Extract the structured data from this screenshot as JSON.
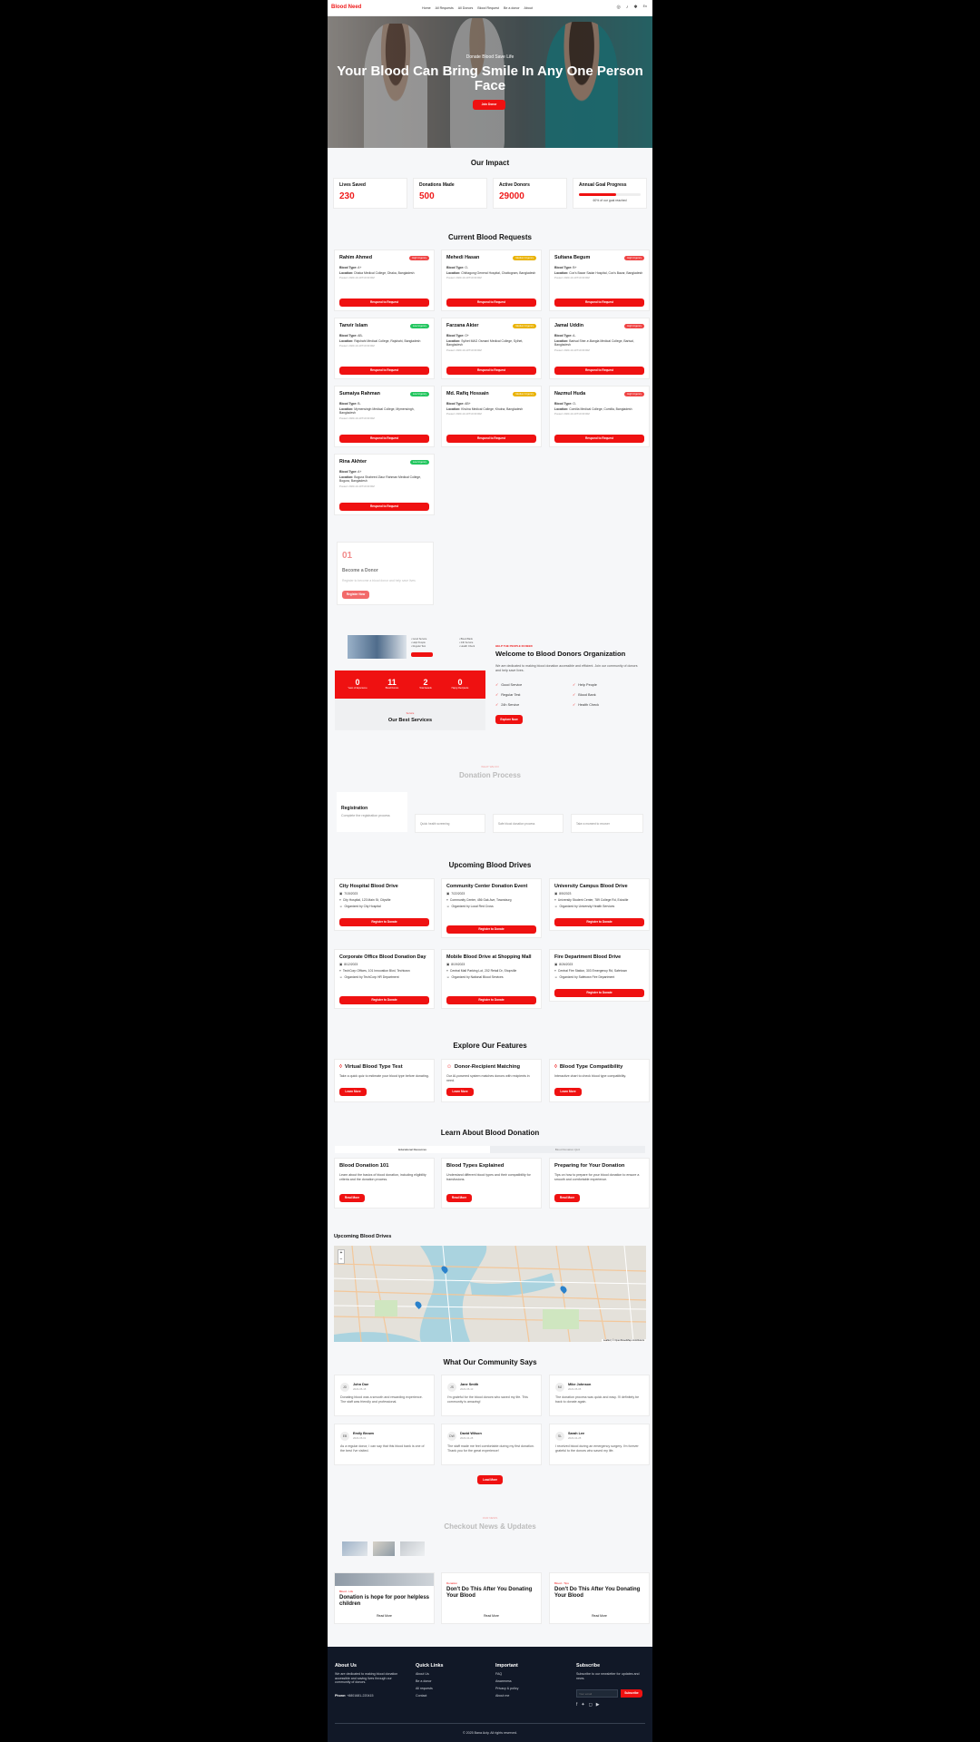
{
  "nav": {
    "logo": "Blood Need",
    "links": [
      "Home",
      "All Requests",
      "All Donors",
      "Blood Request",
      "Be a donor",
      "About"
    ],
    "lang": "En"
  },
  "hero": {
    "kicker": "Donate Blood Save Life",
    "title": "Your Blood Can Bring Smile In Any One Person Face",
    "button": "Join Donor"
  },
  "impact": {
    "title": "Our Impact",
    "stats": [
      {
        "label": "Lives Saved",
        "value": "230"
      },
      {
        "label": "Donations Made",
        "value": "500"
      },
      {
        "label": "Active Donors",
        "value": "29000"
      }
    ],
    "goal_label": "Annual Goal Progress",
    "goal_percent": 60,
    "goal_text": "60% of our goal reached"
  },
  "requests": {
    "title": "Current Blood Requests",
    "blood_type_label": "Blood Type:",
    "location_label": "Location:",
    "button": "Respond to Request",
    "items": [
      {
        "name": "Rahim Ahmed",
        "urgency": "High Urgency",
        "color": "#ef4444",
        "blood": "A+",
        "location": "Dhaka Medical College, Dhaka, Bangladesh",
        "posted": "Posted: 2023-10-10T10:30:00Z"
      },
      {
        "name": "Mehedi Hasan",
        "urgency": "Medium Urgency",
        "color": "#eab308",
        "blood": "O-",
        "location": "Chittagong General Hospital, Chattogram, Bangladesh",
        "posted": "Posted: 2023-10-10T10:30:00Z"
      },
      {
        "name": "Sultana Begum",
        "urgency": "High Urgency",
        "color": "#ef4444",
        "blood": "B+",
        "location": "Cox's Bazar Sadar Hospital, Cox's Bazar, Bangladesh",
        "posted": "Posted: 2023-10-10T10:30:00Z"
      },
      {
        "name": "Tanvir Islam",
        "urgency": "Low Urgency",
        "color": "#22c55e",
        "blood": "AB-",
        "location": "Rajshahi Medical College, Rajshahi, Bangladesh",
        "posted": "Posted: 2023-10-10T10:30:00Z"
      },
      {
        "name": "Farzana Akter",
        "urgency": "Medium Urgency",
        "color": "#eab308",
        "blood": "O+",
        "location": "Sylhet MAG Osmani Medical College, Sylhet, Bangladesh",
        "posted": "Posted: 2023-10-10T10:30:00Z"
      },
      {
        "name": "Jamal Uddin",
        "urgency": "High Urgency",
        "color": "#ef4444",
        "blood": "A-",
        "location": "Barisal Sher-e-Bangla Medical College, Barisal, Bangladesh",
        "posted": "Posted: 2023-10-10T10:30:00Z"
      },
      {
        "name": "Sumaiya Rahman",
        "urgency": "Low Urgency",
        "color": "#22c55e",
        "blood": "B-",
        "location": "Mymensingh Medical College, Mymensingh, Bangladesh",
        "posted": "Posted: 2023-10-10T10:30:00Z"
      },
      {
        "name": "Md. Rafiq Hossain",
        "urgency": "Medium Urgency",
        "color": "#eab308",
        "blood": "AB+",
        "location": "Khulna Medical College, Khulna, Bangladesh",
        "posted": "Posted: 2023-10-10T10:30:00Z"
      },
      {
        "name": "Nazmul Huda",
        "urgency": "High Urgency",
        "color": "#ef4444",
        "blood": "O-",
        "location": "Comilla Medical College, Cumilla, Bangladesh",
        "posted": "Posted: 2023-10-10T10:30:00Z"
      },
      {
        "name": "Rina Akhter",
        "urgency": "Low Urgency",
        "color": "#22c55e",
        "blood": "A+",
        "location": "Bogura Shaheed Ziaur Rahman Medical College, Bogura, Bangladesh",
        "posted": "Posted: 2023-10-10T10:30:00Z"
      }
    ]
  },
  "become": {
    "number": "01",
    "title": "Become a Donor",
    "text": "Register to become a blood donor and help save lives",
    "button": "Register Now"
  },
  "welcome": {
    "stats": [
      {
        "value": "0",
        "label": "Years of Experience"
      },
      {
        "value": "11",
        "label": "Blood Donors"
      },
      {
        "value": "2",
        "label": "Total Awards"
      },
      {
        "value": "0",
        "label": "Happy Recipients"
      }
    ],
    "services_kicker": "Service",
    "services_title": "Our Best Services",
    "kicker": "HELP THE PEOPLE IN NEED",
    "title": "Welcome to Blood Donors Organization",
    "text": "We are dedicated to making blood donation accessible and efficient. Join our community of donors and help save lives.",
    "checks": [
      "Good Service",
      "Help People",
      "Regular Test",
      "Blood Bank",
      "24h Service",
      "Health Check"
    ],
    "button": "Explore Now"
  },
  "process": {
    "kicker": "WHAT WE DO",
    "title": "Donation Process",
    "step_title": "Registration",
    "step_text": "Complete the registration process",
    "steps": [
      "Quick health screening",
      "Safe blood donation process",
      "Take a moment to recover"
    ]
  },
  "drives": {
    "title": "Upcoming Blood Drives",
    "button": "Register to Donate",
    "items": [
      {
        "name": "City Hospital Blood Drive",
        "date": "7/15/2023",
        "place": "City Hospital, 123 Main St, Cityville",
        "org": "Organized by City Hospital"
      },
      {
        "name": "Community Center Donation Event",
        "date": "7/22/2023",
        "place": "Community Center, 456 Oak Ave, Townsburg",
        "org": "Organized by Local Red Cross"
      },
      {
        "name": "University Campus Blood Drive",
        "date": "8/5/2023",
        "place": "University Student Center, 789 College Rd, Eduville",
        "org": "Organized by University Health Services"
      },
      {
        "name": "Corporate Office Blood Donation Day",
        "date": "8/12/2023",
        "place": "TechCorp Offices, 101 Innovation Blvd, Techtown",
        "org": "Organized by TechCorp HR Department"
      },
      {
        "name": "Mobile Blood Drive at Shopping Mall",
        "date": "8/19/2023",
        "place": "Central Mall Parking Lot, 202 Retail Dr, Shopville",
        "org": "Organized by National Blood Services"
      },
      {
        "name": "Fire Department Blood Drive",
        "date": "8/26/2023",
        "place": "Central Fire Station, 303 Emergency Rd, Safetown",
        "org": "Organized by Safetown Fire Department"
      }
    ]
  },
  "features": {
    "title": "Explore Our Features",
    "button": "Learn More",
    "items": [
      {
        "name": "Virtual Blood Type Test",
        "text": "Take a quick quiz to estimate your blood type before donating."
      },
      {
        "name": "Donor-Recipient Matching",
        "text": "Our AI-powered system matches donors with recipients in need."
      },
      {
        "name": "Blood Type Compatibility",
        "text": "Interactive chart to check blood type compatibility."
      }
    ]
  },
  "learn": {
    "title": "Learn About Blood Donation",
    "tabs": [
      "Educational Resources",
      "Blood Donation Quiz"
    ],
    "button": "Read More",
    "items": [
      {
        "name": "Blood Donation 101",
        "text": "Learn about the basics of blood donation, including eligibility criteria and the donation process."
      },
      {
        "name": "Blood Types Explained",
        "text": "Understand different blood types and their compatibility for transfusions."
      },
      {
        "name": "Preparing for Your Donation",
        "text": "Tips on how to prepare for your blood donation to ensure a smooth and comfortable experience."
      }
    ]
  },
  "map": {
    "title": "Upcoming Blood Drives",
    "zoom_in": "+",
    "zoom_out": "−",
    "attribution": "Leaflet | © OpenStreetMap contributors"
  },
  "testimonials": {
    "title": "What Our Community Says",
    "button": "Load More",
    "items": [
      {
        "initials": "JD",
        "name": "John Doe",
        "date": "2023-05-15",
        "text": "Donating blood was a smooth and rewarding experience. The staff was friendly and professional."
      },
      {
        "initials": "JS",
        "name": "Jane Smith",
        "date": "2023-05-10",
        "text": "I'm grateful for the blood donors who saved my life. This community is amazing!"
      },
      {
        "initials": "MJ",
        "name": "Mike Johnson",
        "date": "2023-05-05",
        "text": "The donation process was quick and easy. I'll definitely be back to donate again."
      },
      {
        "initials": "EB",
        "name": "Emily Brown",
        "date": "2023-05-01",
        "text": "As a regular donor, I can say that this blood bank is one of the best I've visited."
      },
      {
        "initials": "DW",
        "name": "David Wilson",
        "date": "2023-04-28",
        "text": "The staff made me feel comfortable during my first donation. Thank you for the great experience!"
      },
      {
        "initials": "SL",
        "name": "Sarah Lee",
        "date": "2023-04-25",
        "text": "I received blood during an emergency surgery. I'm forever grateful to the donors who saved my life."
      }
    ]
  },
  "news": {
    "kicker": "OUR NEWS",
    "title": "Checkout News & Updates",
    "read_more": "Read More",
    "items": [
      {
        "tag": "Blood - Life",
        "name": "Donation is hope for poor helpless children"
      },
      {
        "tag": "Donation",
        "name": "Don't Do This After You Donating Your Blood"
      },
      {
        "tag": "Blood - Tips",
        "name": "Don't Do This After You Donating Your Blood"
      }
    ]
  },
  "footer": {
    "about_title": "About Us",
    "about_text": "We are dedicated to making blood donation accessible and saving lives through our community of donors.",
    "phone_label": "Phone:",
    "phone": "+8801681-220415",
    "quick_title": "Quick Links",
    "quick_links": [
      "About Us",
      "Be a donor",
      "All requests",
      "Contact"
    ],
    "important_title": "Important",
    "important_links": [
      "FAQ",
      "Awareness",
      "Privacy & policy",
      "About me"
    ],
    "subscribe_title": "Subscribe",
    "subscribe_text": "Subscribe to our newsletter for updates and news.",
    "email_placeholder": "Your email",
    "subscribe_button": "Subscribe",
    "copyright": "© 2025 Bana Acty. All rights reserved."
  }
}
